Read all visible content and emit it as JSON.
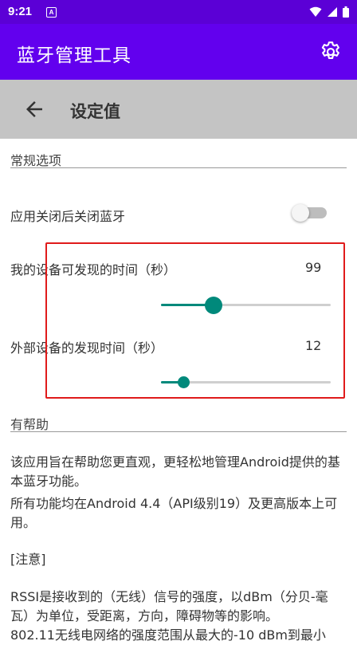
{
  "status_bar": {
    "time": "9:21",
    "notification_icon_letter": "A",
    "icons": [
      "wifi-icon",
      "signal-icon",
      "battery-icon"
    ]
  },
  "app_bar": {
    "title": "蓝牙管理工具",
    "settings_icon": "gear-icon",
    "color": "#6200ee"
  },
  "sub_bar": {
    "title": "设定值",
    "back_icon": "arrow-left-icon"
  },
  "general": {
    "header": "常规选项",
    "close_bt_on_exit": {
      "label": "应用关闭后关闭蓝牙",
      "enabled": false
    },
    "discoverable_time": {
      "label": "我的设备可发现的时间（秒）",
      "value": "99",
      "slider_fraction": 0.31
    },
    "external_discovery_time": {
      "label": "外部设备的发现时间（秒）",
      "value": "12",
      "slider_fraction": 0.13
    }
  },
  "help": {
    "header": "有帮助",
    "paragraph1": "该应用旨在帮助您更直观，更轻松地管理Android提供的基本蓝牙功能。",
    "paragraph2": "所有功能均在Android 4.4（API级别19）及更高版本上可用。",
    "note_label": "[注意]",
    "rssi_text": "RSSI是接收到的（无线）信号的强度，以dBm（分贝-毫瓦）为单位，受距离，方向，障碍物等的影响。",
    "cutoff_line": "802.11无线电网络的强度范围从最大的-10 dBm到最小"
  },
  "colors": {
    "accent": "#00897b",
    "highlight_box": "#e01b1b"
  }
}
